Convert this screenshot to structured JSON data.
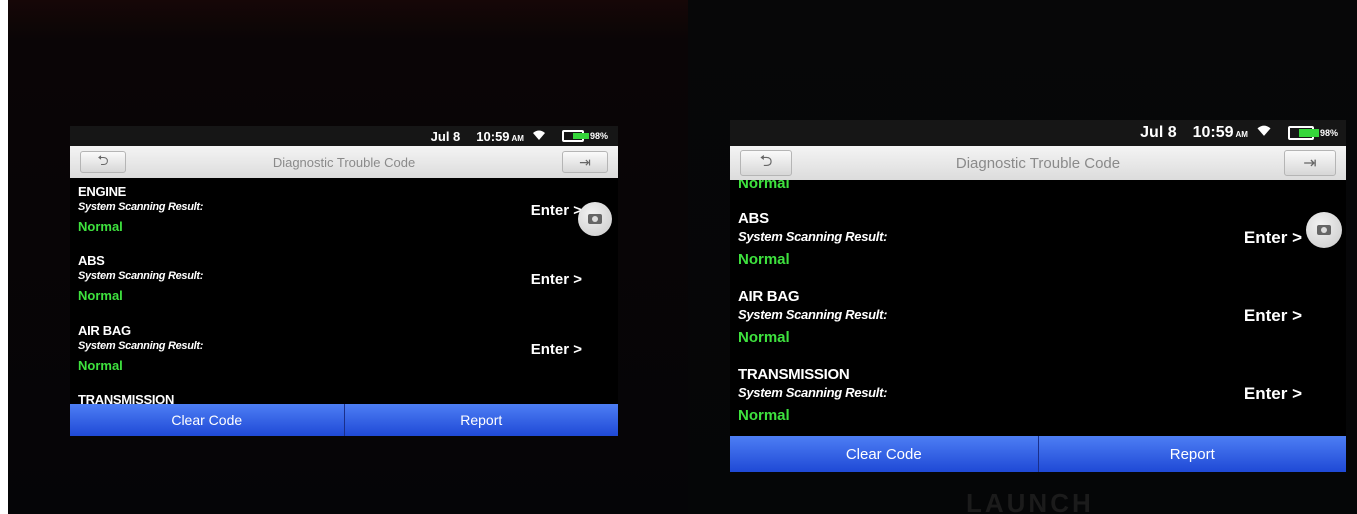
{
  "status_bar": {
    "date": "Jul 8",
    "time": "10:59",
    "ampm": "AM",
    "battery_percent": "98%",
    "battery_level": 0.98
  },
  "title_bar": {
    "title": "Diagnostic Trouble Code"
  },
  "scan_label": "System Scanning Result:",
  "enter_label": "Enter >",
  "left_view": {
    "systems": [
      {
        "name": "ENGINE",
        "status": "Normal"
      },
      {
        "name": "ABS",
        "status": "Normal"
      },
      {
        "name": "AIR BAG",
        "status": "Normal"
      },
      {
        "name": "TRANSMISSION",
        "status": ""
      }
    ]
  },
  "right_view": {
    "top_status": "Normal",
    "systems": [
      {
        "name": "ABS",
        "status": "Normal"
      },
      {
        "name": "AIR BAG",
        "status": "Normal"
      },
      {
        "name": "TRANSMISSION",
        "status": "Normal"
      }
    ]
  },
  "bottom_bar": {
    "clear_code": "Clear Code",
    "report": "Report"
  },
  "device_brand": "LAUNCH",
  "colors": {
    "status_normal": "#3ee23e",
    "button_blue": "#2f5fe6",
    "title_bar": "#e8e8e8"
  },
  "icons": [
    "back-arrow-icon",
    "exit-icon",
    "wifi-icon",
    "battery-icon",
    "camera-icon"
  ]
}
